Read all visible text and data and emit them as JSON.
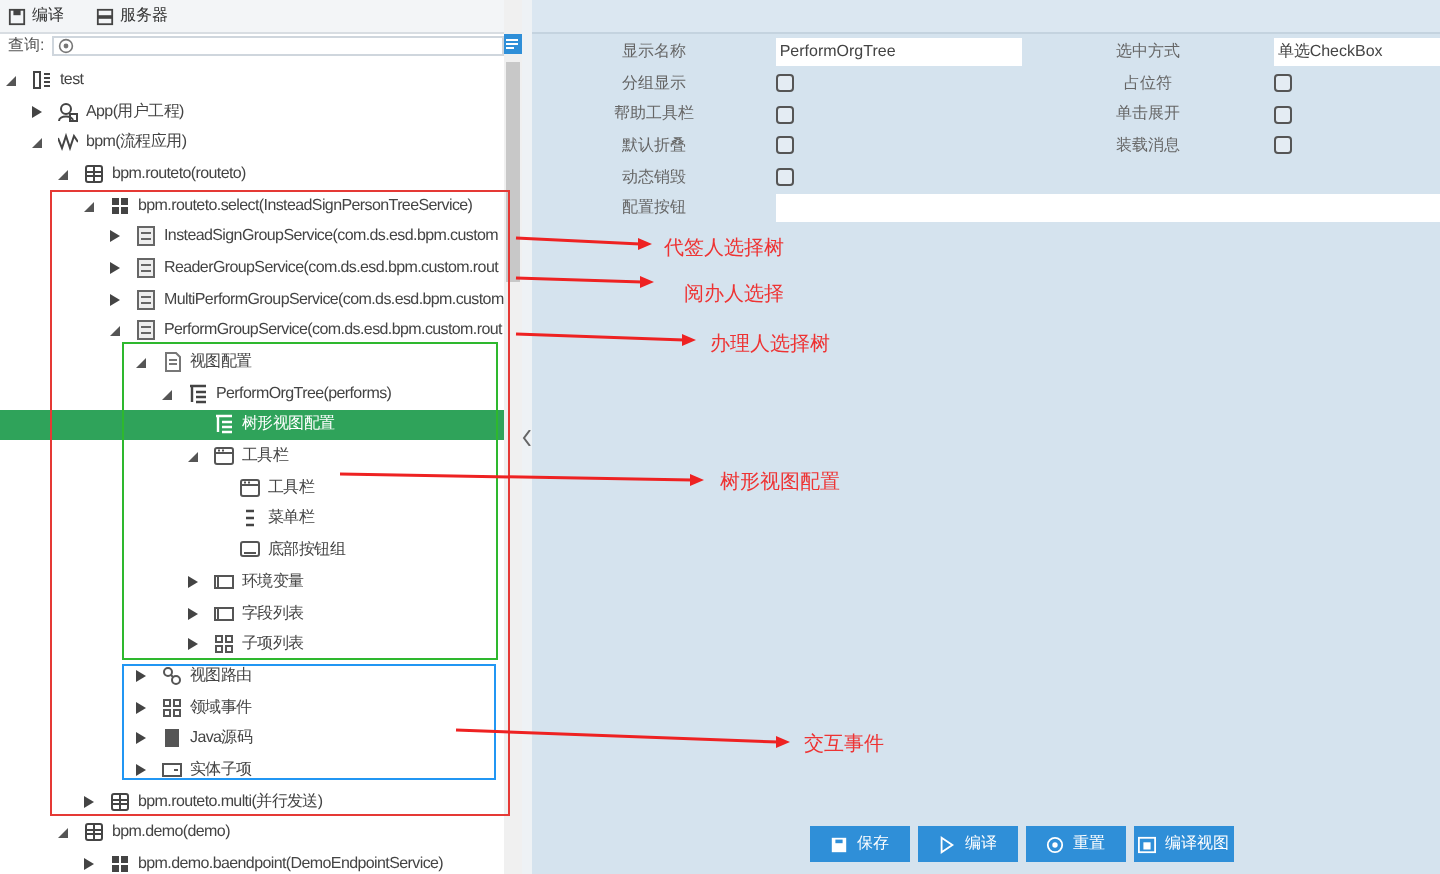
{
  "toolbar": [
    {
      "label": "编译",
      "kind": "compile"
    },
    {
      "label": "服务器",
      "kind": "server"
    }
  ],
  "search": {
    "label": "查询:"
  },
  "tree": [
    {
      "label": "test",
      "kind": "project",
      "expanded": true,
      "selected": false,
      "children": [
        {
          "label": "App(用户工程)",
          "kind": "app",
          "expanded": false,
          "selected": false
        },
        {
          "label": "bpm(流程应用)",
          "kind": "flow",
          "expanded": true,
          "selected": false,
          "children": [
            {
              "label": "bpm.routeto(routeto)",
              "kind": "package",
              "expanded": true,
              "selected": false,
              "children": [
                {
                  "label": "bpm.routeto.select(InsteadSignPersonTreeService)",
                  "kind": "service",
                  "expanded": true,
                  "selected": false,
                  "children": [
                    {
                      "label": "InsteadSignGroupService(com.ds.esd.bpm.custom",
                      "kind": "group",
                      "expanded": false,
                      "selected": false
                    },
                    {
                      "label": "ReaderGroupService(com.ds.esd.bpm.custom.rout",
                      "kind": "group",
                      "expanded": false,
                      "selected": false
                    },
                    {
                      "label": "MultiPerformGroupService(com.ds.esd.bpm.custom",
                      "kind": "group",
                      "expanded": false,
                      "selected": false
                    },
                    {
                      "label": "PerformGroupService(com.ds.esd.bpm.custom.rout",
                      "kind": "group",
                      "expanded": true,
                      "selected": false,
                      "children": [
                        {
                          "label": "视图配置",
                          "kind": "config",
                          "expanded": true,
                          "selected": false,
                          "children": [
                            {
                              "label": "PerformOrgTree(performs)",
                              "kind": "tree",
                              "expanded": true,
                              "selected": false,
                              "children": [
                                {
                                  "label": "树形视图配置",
                                  "kind": "tree",
                                  "selected": true
                                },
                                {
                                  "label": "工具栏",
                                  "kind": "toolbar",
                                  "expanded": true,
                                  "selected": false,
                                  "children": [
                                    {
                                      "label": "工具栏",
                                      "kind": "toolbar",
                                      "selected": false
                                    },
                                    {
                                      "label": "菜单栏",
                                      "kind": "menu",
                                      "selected": false
                                    },
                                    {
                                      "label": "底部按钮组",
                                      "kind": "footer",
                                      "selected": false
                                    }
                                  ]
                                },
                                {
                                  "label": "环境变量",
                                  "kind": "panel",
                                  "expanded": false,
                                  "selected": false
                                },
                                {
                                  "label": "字段列表",
                                  "kind": "panel",
                                  "expanded": false,
                                  "selected": false
                                },
                                {
                                  "label": "子项列表",
                                  "kind": "grid",
                                  "expanded": false,
                                  "selected": false
                                }
                              ]
                            }
                          ]
                        },
                        {
                          "label": "视图路由",
                          "kind": "route",
                          "expanded": false,
                          "selected": false
                        },
                        {
                          "label": "领域事件",
                          "kind": "grid",
                          "expanded": false,
                          "selected": false
                        },
                        {
                          "label": "Java源码",
                          "kind": "java",
                          "expanded": false,
                          "selected": false
                        },
                        {
                          "label": "实体子项",
                          "kind": "entity",
                          "expanded": false,
                          "selected": false
                        }
                      ]
                    }
                  ]
                },
                {
                  "label": "bpm.routeto.multi(并行发送)",
                  "kind": "package",
                  "expanded": false,
                  "selected": false
                }
              ]
            },
            {
              "label": "bpm.demo(demo)",
              "kind": "package",
              "expanded": true,
              "selected": false,
              "children": [
                {
                  "label": "bpm.demo.baendpoint(DemoEndpointService)",
                  "kind": "service",
                  "expanded": false,
                  "selected": false
                }
              ]
            }
          ]
        }
      ]
    }
  ],
  "form": {
    "rows": [
      [
        {
          "label": "显示名称",
          "kind": "text",
          "value": "PerformOrgTree"
        },
        {
          "label": "选中方式",
          "kind": "text",
          "value": "单选CheckBox"
        }
      ],
      [
        {
          "label": "分组显示",
          "kind": "checkbox",
          "checked": false
        },
        {
          "label": "占位符",
          "kind": "checkbox",
          "checked": false
        }
      ],
      [
        {
          "label": "帮助工具栏",
          "kind": "checkbox",
          "checked": false
        },
        {
          "label": "单击展开",
          "kind": "checkbox",
          "checked": false
        }
      ],
      [
        {
          "label": "默认折叠",
          "kind": "checkbox",
          "checked": false
        },
        {
          "label": "装载消息",
          "kind": "checkbox",
          "checked": false
        }
      ],
      [
        {
          "label": "动态销毁",
          "kind": "checkbox",
          "checked": false
        }
      ],
      [
        {
          "label": "配置按钮",
          "kind": "wide_text"
        }
      ]
    ]
  },
  "buttons": [
    {
      "label": "保存",
      "kind": "save"
    },
    {
      "label": "编译",
      "kind": "compile"
    },
    {
      "label": "重置",
      "kind": "reset"
    },
    {
      "label": "编译视图",
      "kind": "view"
    }
  ],
  "annotations": {
    "boxes": [
      {
        "color": "#e53935"
      },
      {
        "color": "#2eb82e"
      },
      {
        "color": "#2196f3"
      }
    ],
    "labels": [
      {
        "text": "代签人选择树"
      },
      {
        "text": "阅办人选择"
      },
      {
        "text": "办理人选择树"
      },
      {
        "text": "树形视图配置"
      },
      {
        "text": "交互事件"
      }
    ]
  }
}
